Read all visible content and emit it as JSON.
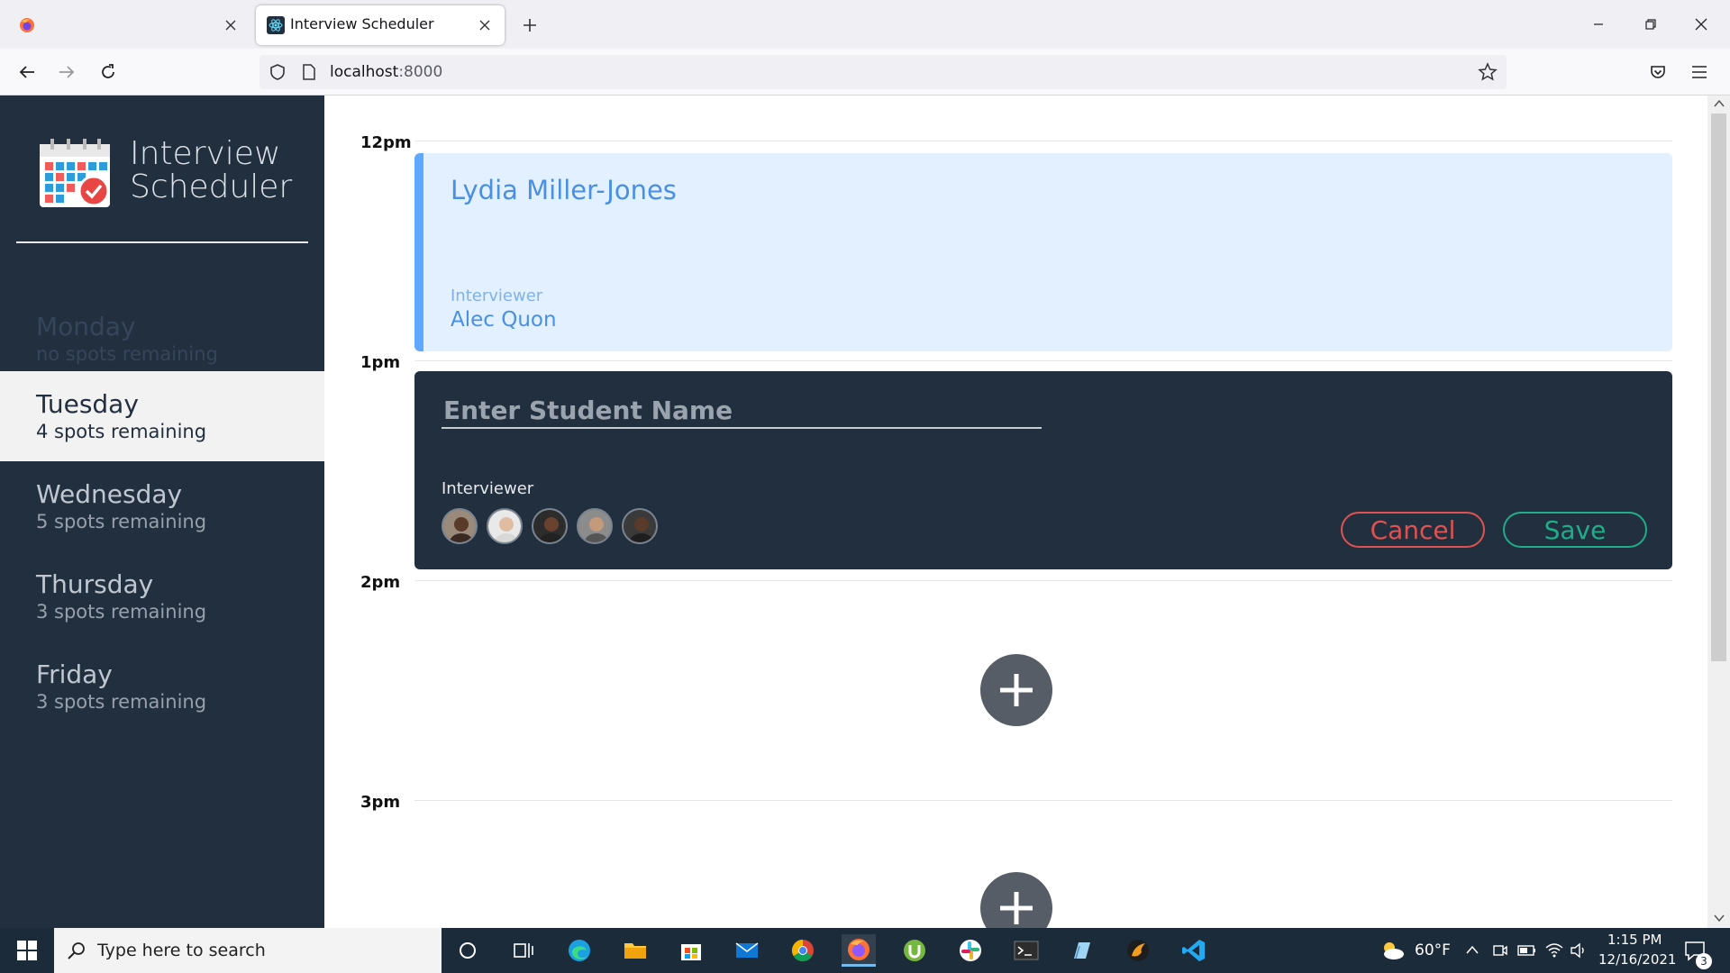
{
  "browser": {
    "tabs": [
      {
        "title": "",
        "active": false
      },
      {
        "title": "Interview Scheduler",
        "active": true
      }
    ],
    "url": {
      "host": "localhost",
      "port": ":8000"
    }
  },
  "app": {
    "logo_line1": "Interview",
    "logo_line2": "Scheduler",
    "days": [
      {
        "name": "Monday",
        "spots": "no spots remaining",
        "state": "full"
      },
      {
        "name": "Tuesday",
        "spots": "4 spots remaining",
        "state": "selected"
      },
      {
        "name": "Wednesday",
        "spots": "5 spots remaining",
        "state": "normal"
      },
      {
        "name": "Thursday",
        "spots": "3 spots remaining",
        "state": "normal"
      },
      {
        "name": "Friday",
        "spots": "3 spots remaining",
        "state": "normal"
      }
    ],
    "times": [
      "12pm",
      "1pm",
      "2pm",
      "3pm"
    ],
    "appointment": {
      "student": "Lydia Miller-Jones",
      "interviewer_label": "Interviewer",
      "interviewer_name": "Alec Quon"
    },
    "form": {
      "placeholder": "Enter Student Name",
      "interviewer_label": "Interviewer",
      "cancel": "Cancel",
      "save": "Save"
    }
  },
  "taskbar": {
    "search_placeholder": "Type here to search",
    "weather": "60°F",
    "time": "1:15 PM",
    "date": "12/16/2021",
    "notifications": "3"
  },
  "colors": {
    "sidebar": "#222f3e",
    "appointment_bg": "#e2f0ff",
    "appointment_accent": "#5fa8ff",
    "cancel": "#e05252",
    "save": "#1fae8a"
  }
}
